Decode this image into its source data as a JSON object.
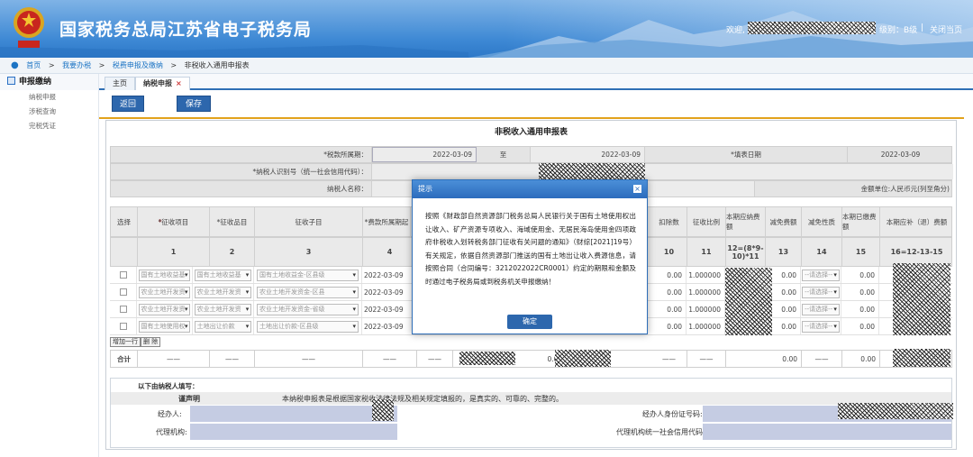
{
  "header": {
    "site_title": "国家税务总局江苏省电子税务局",
    "welcome": "欢迎,",
    "level": "级别：B级",
    "separator": "|",
    "logout": "关闭当页"
  },
  "breadcrumb": [
    "首页",
    ">",
    "我要办税",
    ">",
    "税费申报及缴纳",
    ">",
    "非税收入通用申报表"
  ],
  "sidebar": {
    "title": "申报缴纳",
    "items": [
      "纳税申报",
      "涉税查询",
      "完税凭证"
    ]
  },
  "tabs": [
    {
      "label": "主页"
    },
    {
      "label": "纳税申报",
      "close": "×"
    }
  ],
  "toolbar": {
    "back": "返回",
    "save": "保存"
  },
  "form": {
    "title": "非税收入通用申报表",
    "period_label": "*税款所属期：",
    "period_start": "2022-03-09",
    "period_to": "至",
    "period_end": "2022-03-09",
    "fill_date_label": "*填表日期",
    "fill_date": "2022-03-09",
    "taxpayer_id_label": "*纳税人识别号（统一社会信用代码）：",
    "taxpayer_name_label": "纳税人名称：",
    "unit_label": "金额单位:人民币元(列至角分)",
    "columns": [
      "选择",
      "*征收项目",
      "*征收品目",
      "征收子目",
      "*费款所属期起",
      "*",
      "扣除数",
      "征收比例",
      "本期应纳费额",
      "减免费额",
      "减免性质",
      "本期已缴费额",
      "本期应补（退）费额"
    ],
    "col_numbers": [
      "1",
      "2",
      "3",
      "4",
      "10",
      "11",
      "12=(8*9-10)*11",
      "13",
      "14",
      "15",
      "16=12-13-15"
    ],
    "rows": [
      {
        "item": "国有土地收益基",
        "pinmu": "国有土地收益基",
        "zimu": "国有土地收益金-区县级",
        "start": "2022-03-09",
        "deduct": "0.00",
        "ratio": "1.000000",
        "relief": "0.00",
        "nature": "--请选择--",
        "paid": "0.00"
      },
      {
        "item": "农业土地开发资",
        "pinmu": "农业土地开发资",
        "zimu": "农业土地开发资金-区县",
        "start": "2022-03-09",
        "deduct": "0.00",
        "ratio": "1.000000",
        "relief": "0.00",
        "nature": "--请选择--",
        "paid": "0.00"
      },
      {
        "item": "农业土地开发资",
        "pinmu": "农业土地开发资",
        "zimu": "农业土地开发资金-省级",
        "start": "2022-03-09",
        "deduct": "0.00",
        "ratio": "1.000000",
        "relief": "0.00",
        "nature": "--请选择--",
        "paid": "0.00"
      },
      {
        "item": "国有土地使用权",
        "pinmu": "土地出让价款",
        "zimu": "土地出让价款-区县级",
        "start": "2022-03-09",
        "deduct": "0.00",
        "ratio": "1.000000",
        "relief": "0.00",
        "nature": "--请选择--",
        "paid": "0.00"
      }
    ],
    "add_row": "增加一行",
    "delete_row": "删 除",
    "total_label": "合计",
    "dash": "——",
    "total_value": "0.000",
    "total_relief": "0.00",
    "total_paid": "0.00",
    "declare_fill": "以下由纳税人填写：",
    "statement_label": "谨声明",
    "statement_text": "本纳税申报表是根据国家税收法律法规及相关规定填报的，是真实的、可靠的、完整的。",
    "handler_label": "经办人:",
    "handler_id_label": "经办人身份证号码:",
    "agent_label": "代理机构:",
    "agent_code_label": "代理机构统一社会信用代码:"
  },
  "modal": {
    "title": "提示",
    "close": "×",
    "body": "按照《财政部自然资源部门税务总局人民银行关于国有土地使用权出让收入、矿产资源专项收入、海域使用金、无居民海岛使用金四项政府非税收入划转税务部门征收有关问题的通知》（财综[2021]19号）有关规定，依据自然资源部门推送的国有土地出让收入费源信息，请按照合同（合同编号：3212022022CR0001）约定的期限和金额及时通过电子税务局或到税务机关申报缴纳！",
    "confirm": "确定"
  }
}
